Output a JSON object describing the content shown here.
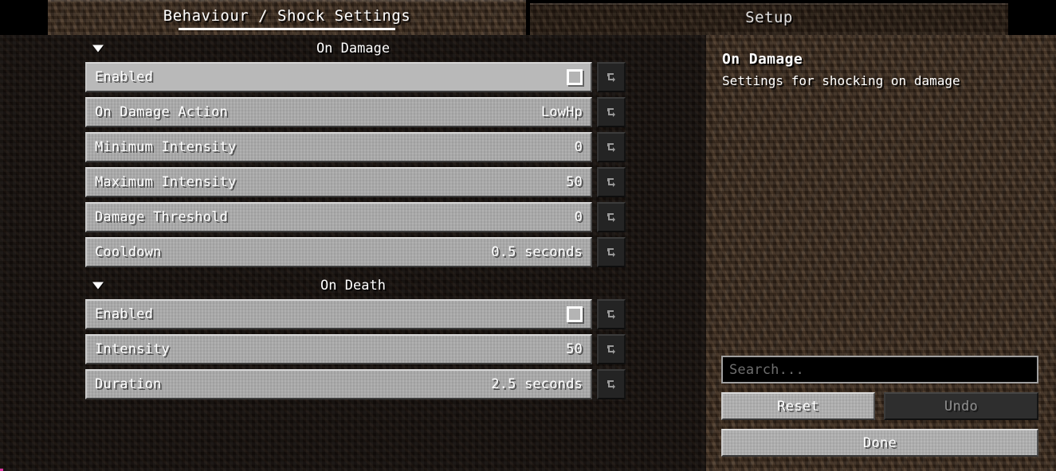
{
  "window": {
    "title": "Behaviour / Shock Settings"
  },
  "tabs": [
    {
      "label": "Behaviour / Shock Settings",
      "selected": true
    },
    {
      "label": "Setup",
      "selected": false
    }
  ],
  "sections": [
    {
      "title": "On Damage",
      "expanded": true,
      "collapse_icon": "triangle-down-icon",
      "options": [
        {
          "label": "Enabled",
          "control": "checkbox",
          "value": "",
          "checked": false,
          "hovered": true,
          "reset_icon": "reset-arrow-icon"
        },
        {
          "label": "On Damage Action",
          "control": "cycle",
          "value": "LowHp",
          "hovered": false,
          "reset_icon": "reset-arrow-icon"
        },
        {
          "label": "Minimum Intensity",
          "control": "number",
          "value": "0",
          "hovered": false,
          "reset_icon": "reset-arrow-icon"
        },
        {
          "label": "Maximum Intensity",
          "control": "number",
          "value": "50",
          "hovered": false,
          "reset_icon": "reset-arrow-icon"
        },
        {
          "label": "Damage Threshold",
          "control": "number",
          "value": "0",
          "hovered": false,
          "reset_icon": "reset-arrow-icon"
        },
        {
          "label": "Cooldown",
          "control": "slider",
          "value": "0.5 seconds",
          "hovered": false,
          "reset_icon": "reset-arrow-icon"
        }
      ]
    },
    {
      "title": "On Death",
      "expanded": true,
      "collapse_icon": "triangle-down-icon",
      "options": [
        {
          "label": "Enabled",
          "control": "checkbox",
          "value": "",
          "checked": false,
          "hovered": false,
          "reset_icon": "reset-arrow-icon"
        },
        {
          "label": "Intensity",
          "control": "number",
          "value": "50",
          "hovered": false,
          "reset_icon": "reset-arrow-icon"
        },
        {
          "label": "Duration",
          "control": "slider",
          "value": "2.5 seconds",
          "hovered": false,
          "reset_icon": "reset-arrow-icon"
        }
      ]
    }
  ],
  "details": {
    "title": "On Damage",
    "description": "Settings for shocking on damage"
  },
  "search": {
    "value": "",
    "placeholder": "Search..."
  },
  "buttons": {
    "reset": {
      "label": "Reset",
      "enabled": true
    },
    "undo": {
      "label": "Undo",
      "enabled": false
    },
    "done": {
      "label": "Done",
      "enabled": true
    }
  },
  "colors": {
    "panel_dark": "#130e0b",
    "panel_brown": "#352619",
    "button_face": "#aaaaaa",
    "button_face_hover": "#b9b9b9",
    "button_disabled": "#2e2e2e",
    "text": "#ffffff",
    "text_disabled": "#8e8e8e",
    "placeholder": "#6e6e6e"
  }
}
